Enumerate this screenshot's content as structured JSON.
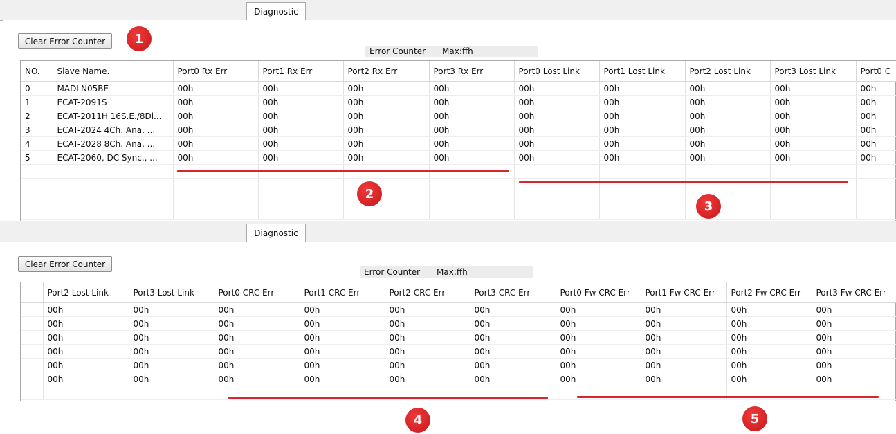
{
  "tab_label": "Diagnostic",
  "clear_button_label": "Clear Error Counter",
  "error_counter": {
    "label": "Error Counter",
    "max": "Max:ffh"
  },
  "table1": {
    "headers": [
      "NO.",
      "Slave Name.",
      "Port0 Rx Err",
      "Port1 Rx Err",
      "Port2 Rx Err",
      "Port3 Rx Err",
      "Port0 Lost Link",
      "Port1 Lost Link",
      "Port2 Lost Link",
      "Port3 Lost Link",
      "Port0 C"
    ],
    "rows": [
      [
        "0",
        "MADLN05BE",
        "00h",
        "00h",
        "00h",
        "00h",
        "00h",
        "00h",
        "00h",
        "00h",
        "00h"
      ],
      [
        "1",
        "ECAT-2091S",
        "00h",
        "00h",
        "00h",
        "00h",
        "00h",
        "00h",
        "00h",
        "00h",
        "00h"
      ],
      [
        "2",
        "ECAT-2011H 16S.E./8Di...",
        "00h",
        "00h",
        "00h",
        "00h",
        "00h",
        "00h",
        "00h",
        "00h",
        "00h"
      ],
      [
        "3",
        "ECAT-2024 4Ch. Ana. ...",
        "00h",
        "00h",
        "00h",
        "00h",
        "00h",
        "00h",
        "00h",
        "00h",
        "00h"
      ],
      [
        "4",
        "ECAT-2028 8Ch. Ana. ...",
        "00h",
        "00h",
        "00h",
        "00h",
        "00h",
        "00h",
        "00h",
        "00h",
        "00h"
      ],
      [
        "5",
        "ECAT-2060, DC Sync., ...",
        "00h",
        "00h",
        "00h",
        "00h",
        "00h",
        "00h",
        "00h",
        "00h",
        "00h"
      ]
    ]
  },
  "table2": {
    "headers": [
      "Port2 Lost Link",
      "Port3 Lost Link",
      "Port0 CRC Err",
      "Port1 CRC Err",
      "Port2 CRC Err",
      "Port3 CRC Err",
      "Port0 Fw CRC Err",
      "Port1 Fw CRC Err",
      "Port2 Fw CRC Err",
      "Port3 Fw CRC Err"
    ],
    "rows": [
      [
        "00h",
        "00h",
        "00h",
        "00h",
        "00h",
        "00h",
        "00h",
        "00h",
        "00h",
        "00h"
      ],
      [
        "00h",
        "00h",
        "00h",
        "00h",
        "00h",
        "00h",
        "00h",
        "00h",
        "00h",
        "00h"
      ],
      [
        "00h",
        "00h",
        "00h",
        "00h",
        "00h",
        "00h",
        "00h",
        "00h",
        "00h",
        "00h"
      ],
      [
        "00h",
        "00h",
        "00h",
        "00h",
        "00h",
        "00h",
        "00h",
        "00h",
        "00h",
        "00h"
      ],
      [
        "00h",
        "00h",
        "00h",
        "00h",
        "00h",
        "00h",
        "00h",
        "00h",
        "00h",
        "00h"
      ],
      [
        "00h",
        "00h",
        "00h",
        "00h",
        "00h",
        "00h",
        "00h",
        "00h",
        "00h",
        "00h"
      ]
    ]
  },
  "markers": [
    "1",
    "2",
    "3",
    "4",
    "5"
  ],
  "colors": {
    "marker": "#d7262e",
    "underline": "#d7262e"
  }
}
